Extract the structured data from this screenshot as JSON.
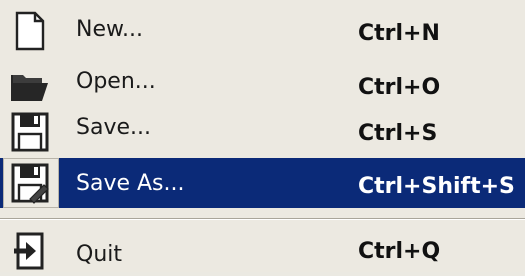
{
  "menu": {
    "items": [
      {
        "label": "New...",
        "shortcut": "Ctrl+N",
        "icon": "new-document-icon"
      },
      {
        "label": "Open...",
        "shortcut": "Ctrl+O",
        "icon": "open-folder-icon"
      },
      {
        "label": "Save...",
        "shortcut": "Ctrl+S",
        "icon": "save-floppy-icon"
      },
      {
        "label": "Save As...",
        "shortcut": "Ctrl+Shift+S",
        "icon": "save-as-icon"
      },
      {
        "label": "Quit",
        "shortcut": "Ctrl+Q",
        "icon": "quit-exit-icon"
      }
    ]
  },
  "colors": {
    "menu_background": "#ece9e1",
    "highlight": "#0b2a78",
    "highlight_text": "#ffffff",
    "text": "#1a1a1a"
  }
}
